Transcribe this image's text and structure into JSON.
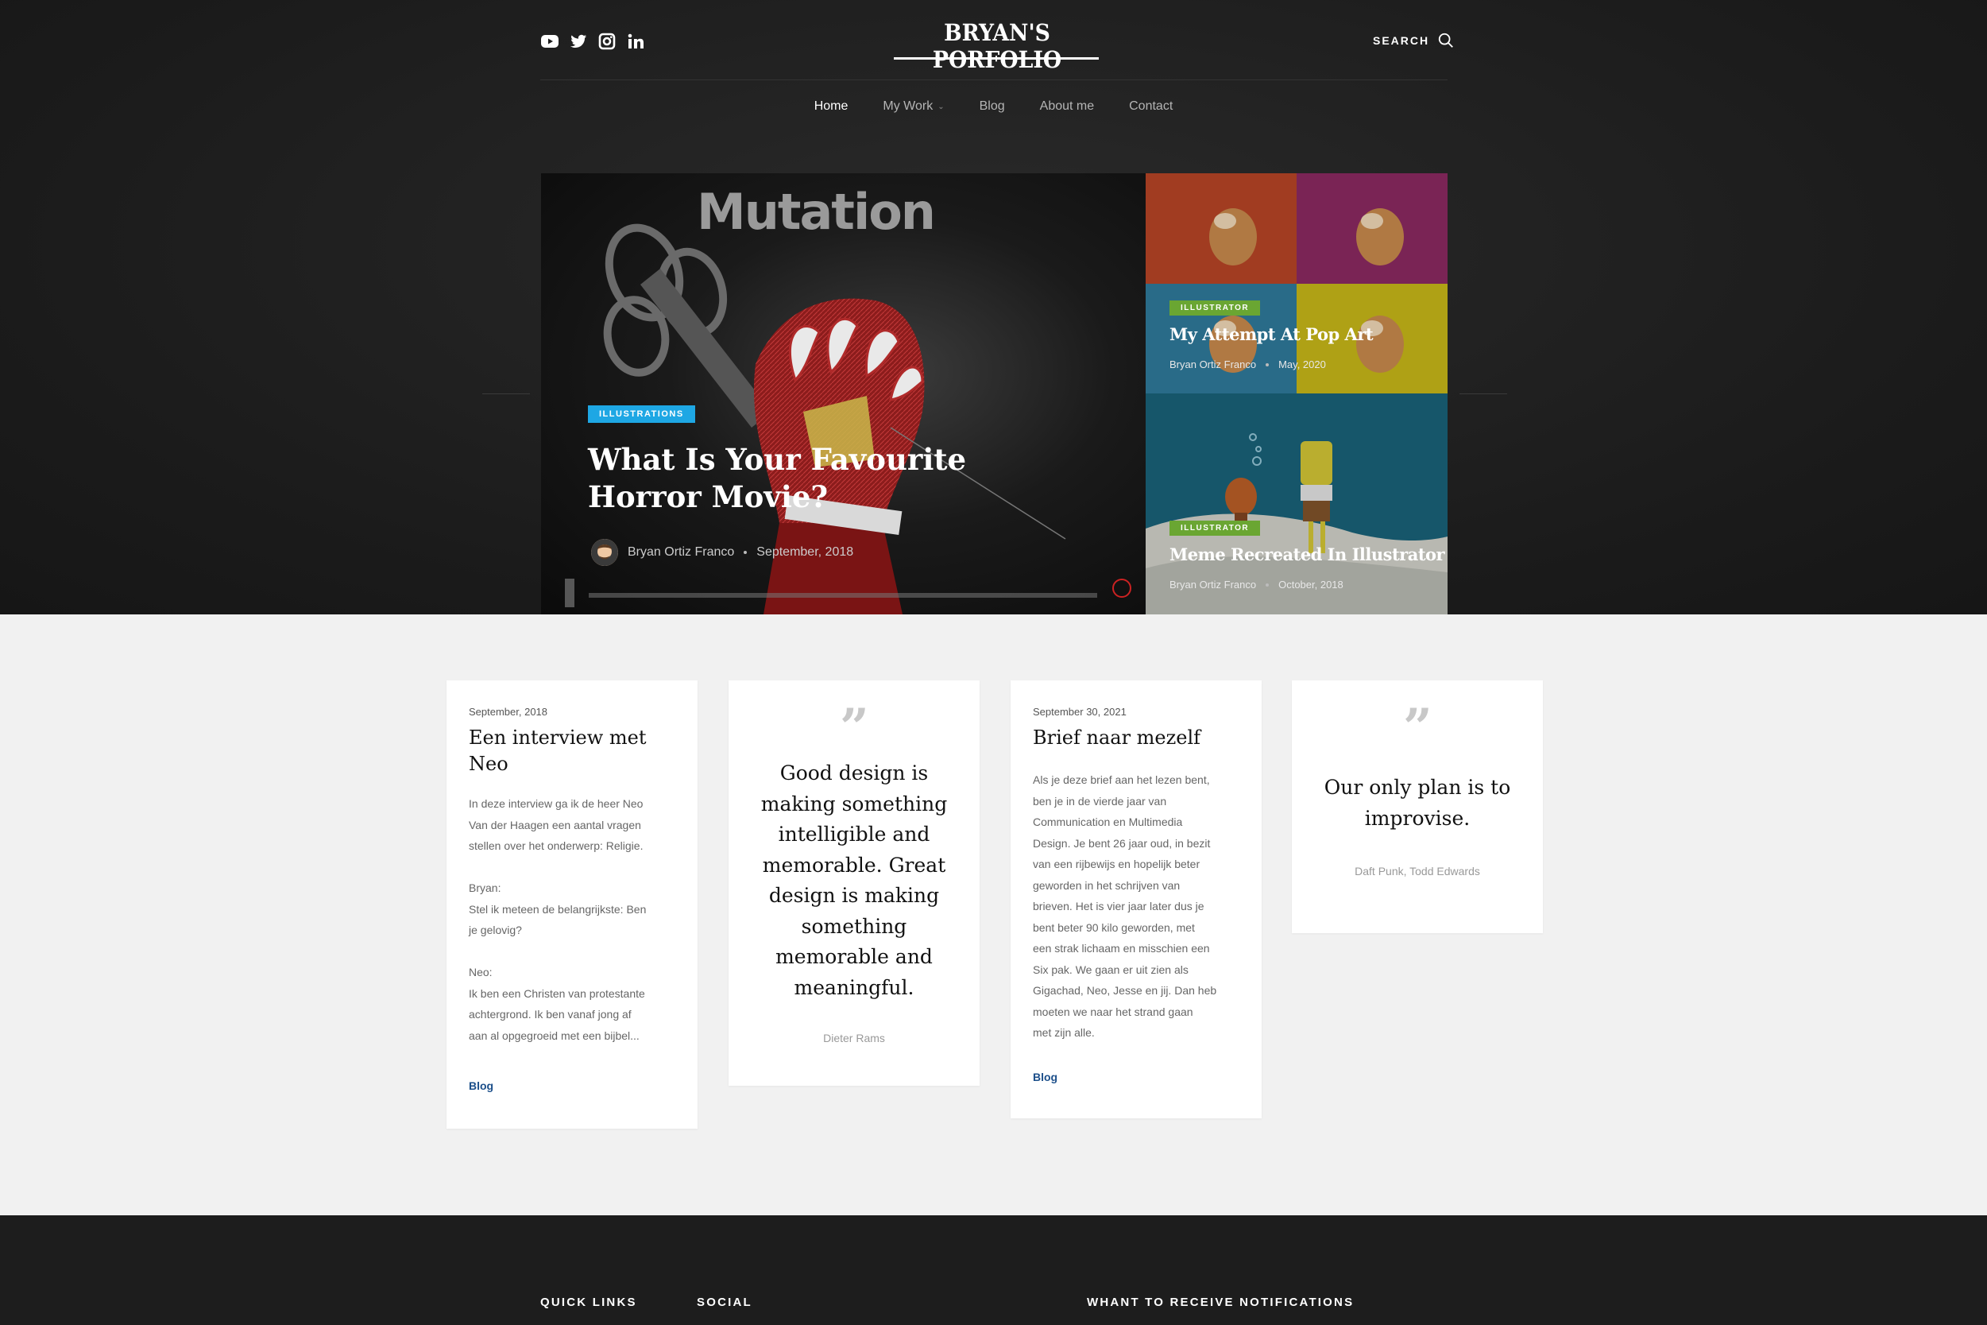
{
  "header": {
    "logo": "BRYAN'S PORFOLIO",
    "search_label": "SEARCH",
    "social_icons": [
      "youtube-icon",
      "twitter-icon",
      "instagram-icon",
      "linkedin-icon"
    ]
  },
  "nav": {
    "items": [
      {
        "label": "Home",
        "active": true
      },
      {
        "label": "My Work",
        "has_dropdown": true
      },
      {
        "label": "Blog"
      },
      {
        "label": "About me"
      },
      {
        "label": "Contact"
      }
    ]
  },
  "hero": {
    "main": {
      "category": "ILLUSTRATIONS",
      "category_color": "#1ea7e4",
      "title": "What Is Your Favourite Horror Movie?",
      "author": "Bryan Ortiz Franco",
      "date": "September, 2018",
      "poster_title": "Mutation"
    },
    "side": [
      {
        "category": "ILLUSTRATOR",
        "category_color": "#6aa632",
        "title": "My Attempt At Pop Art",
        "author": "Bryan Ortiz Franco",
        "date": "May, 2020"
      },
      {
        "category": "ILLUSTRATOR",
        "category_color": "#6aa632",
        "title": "Meme Recreated In Illustrator",
        "author": "Bryan Ortiz Franco",
        "date": "October, 2018"
      }
    ]
  },
  "cards": {
    "c1": {
      "date": "September, 2018",
      "title": "Een interview met Neo",
      "body": "In deze interview ga ik de heer Neo\nVan der Haagen een aantal vragen\nstellen over het onderwerp: Religie.\n\nBryan:\nStel ik meteen de belangrijkste: Ben\nje gelovig?\n\nNeo:\nIk ben een Christen van protestante\nachtergrond. Ik ben vanaf jong af\naan al opgegroeid met een bijbel...",
      "link": "Blog"
    },
    "c2": {
      "quote": "Good design is making something intelligible and memorable. Great design is making something memorable and meaningful.",
      "author": "Dieter Rams"
    },
    "c3": {
      "date": "September 30, 2021",
      "title": "Brief naar mezelf",
      "body": "Als je deze brief aan het lezen bent,\nben je in de vierde jaar van\nCommunication en Multimedia\nDesign. Je bent 26 jaar oud, in bezit\nvan een rijbewijs en hopelijk beter\ngeworden in het schrijven van\nbrieven. Het is vier jaar later dus je\nbent beter 90 kilo geworden, met\neen strak lichaam en misschien een\nSix pak. We gaan er uit zien als\nGigachad, Neo, Jesse en jij. Dan heb\nmoeten we naar het strand gaan\nmet zijn alle.",
      "link": "Blog"
    },
    "c4": {
      "quote": "Our only plan is to improvise.",
      "author": "Daft Punk, Todd Edwards"
    }
  },
  "footer": {
    "quick_links": "QUICK LINKS",
    "social": "SOCIAL",
    "notifications": "WHANT TO RECEIVE NOTIFICATIONS"
  },
  "colors": {
    "dark_bg": "#1b1b1b",
    "light_bg": "#f1f1f1",
    "link_blue": "#1c4f8a"
  }
}
